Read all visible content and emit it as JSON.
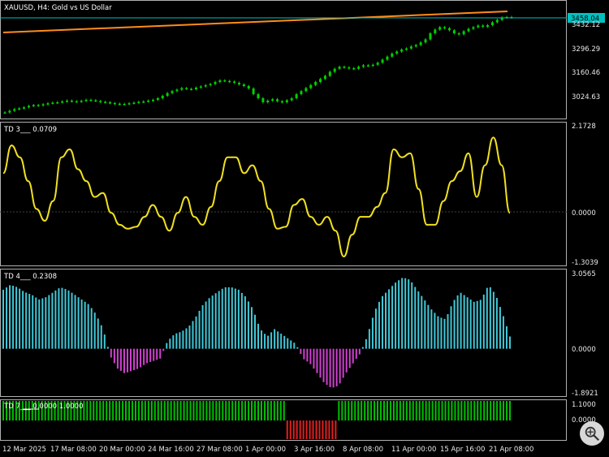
{
  "main": {
    "title": "XAUUSD, H4:  Gold vs US Dollar",
    "price_tag": "3458.04",
    "price_ticks": [
      "3432.12",
      "3296.29",
      "3160.46",
      "3024.63"
    ],
    "prices": [
      2990,
      2998,
      3006,
      3010,
      3015,
      3022,
      3026,
      3024,
      3030,
      3035,
      3038,
      3040,
      3044,
      3048,
      3045,
      3043,
      3047,
      3052,
      3050,
      3046,
      3042,
      3040,
      3036,
      3033,
      3030,
      3032,
      3035,
      3038,
      3042,
      3044,
      3048,
      3052,
      3060,
      3072,
      3085,
      3095,
      3102,
      3110,
      3106,
      3104,
      3112,
      3118,
      3124,
      3130,
      3140,
      3148,
      3145,
      3142,
      3136,
      3128,
      3120,
      3108,
      3080,
      3060,
      3040,
      3048,
      3055,
      3045,
      3040,
      3050,
      3060,
      3080,
      3095,
      3110,
      3125,
      3140,
      3155,
      3170,
      3190,
      3205,
      3215,
      3212,
      3208,
      3205,
      3215,
      3222,
      3220,
      3225,
      3235,
      3250,
      3265,
      3280,
      3290,
      3300,
      3305,
      3315,
      3322,
      3335,
      3350,
      3380,
      3398,
      3410,
      3405,
      3395,
      3380,
      3375,
      3390,
      3402,
      3410,
      3418,
      3412,
      3420,
      3434,
      3446,
      3458,
      3460,
      3458
    ],
    "colors": {
      "price_line": "#00c0c0",
      "candle": "#00d000",
      "trend_line": "#ff8c1a"
    }
  },
  "td3": {
    "label": "TD 3___  0.0709",
    "ticks": [
      "2.1728",
      "0.0000",
      "-1.3039"
    ],
    "max": 2.1728,
    "min": -1.3039,
    "values": [
      1.0,
      1.7,
      1.4,
      0.8,
      0.1,
      -0.2,
      0.3,
      1.4,
      1.6,
      1.1,
      0.8,
      0.4,
      0.5,
      0.0,
      -0.3,
      -0.4,
      -0.35,
      -0.1,
      0.2,
      -0.1,
      -0.45,
      0.0,
      0.4,
      -0.1,
      -0.3,
      0.15,
      0.8,
      1.4,
      1.4,
      1.0,
      1.2,
      0.8,
      0.1,
      -0.4,
      -0.35,
      0.2,
      0.35,
      -0.1,
      -0.3,
      -0.1,
      -0.45,
      -1.1,
      -0.55,
      -0.1,
      -0.1,
      0.15,
      0.5,
      1.6,
      1.4,
      1.5,
      0.6,
      -0.3,
      -0.3,
      0.3,
      0.8,
      1.05,
      1.5,
      0.4,
      1.2,
      1.9,
      1.2,
      0.0
    ],
    "color": "#f0e020"
  },
  "td4": {
    "label": "TD 4___  0.2308",
    "ticks": [
      "3.0565",
      "0.0000",
      "-1.8921"
    ],
    "max": 3.0565,
    "min": -1.8921,
    "values": [
      2.4,
      2.6,
      2.5,
      2.3,
      2.2,
      2.0,
      2.1,
      2.3,
      2.5,
      2.4,
      2.2,
      2.0,
      1.8,
      1.4,
      0.8,
      -0.3,
      -0.8,
      -1.0,
      -0.9,
      -0.8,
      -0.6,
      -0.5,
      -0.4,
      0.3,
      0.6,
      0.7,
      0.9,
      1.3,
      1.8,
      2.1,
      2.3,
      2.5,
      2.5,
      2.4,
      2.1,
      1.6,
      0.8,
      0.5,
      0.8,
      0.6,
      0.4,
      0.2,
      -0.4,
      -0.6,
      -1.0,
      -1.4,
      -1.6,
      -1.5,
      -1.0,
      -0.6,
      -0.2,
      0.5,
      1.5,
      2.1,
      2.4,
      2.7,
      2.9,
      2.8,
      2.4,
      2.0,
      1.6,
      1.3,
      1.2,
      1.9,
      2.3,
      2.1,
      1.9,
      2.0,
      2.6,
      2.2,
      1.4,
      0.5
    ],
    "pos_color": "#40c8d8",
    "neg_color": "#d040d0"
  },
  "td7": {
    "label": "TD 7___  0.0000  1.0000",
    "ticks": [
      "1.1000",
      "0.0000"
    ],
    "states": [
      1,
      1,
      1,
      1,
      1,
      1,
      1,
      1,
      1,
      1,
      1,
      1,
      1,
      1,
      1,
      1,
      1,
      1,
      1,
      1,
      1,
      1,
      1,
      1,
      1,
      1,
      1,
      1,
      1,
      1,
      1,
      1,
      1,
      1,
      1,
      1,
      1,
      1,
      1,
      1,
      1,
      1,
      1,
      1,
      1,
      1,
      1,
      1,
      1,
      1,
      1,
      1,
      1,
      1,
      1,
      1,
      1,
      1,
      1,
      1,
      1,
      1,
      1,
      1,
      1,
      1,
      1,
      1,
      1,
      1,
      1,
      1,
      1,
      1,
      1,
      1,
      1,
      1,
      1,
      1,
      1,
      1,
      1,
      1,
      1,
      1,
      1,
      1,
      0,
      0,
      0,
      0,
      0,
      0,
      0,
      0,
      0,
      0,
      0,
      0,
      0,
      0,
      0,
      0,
      1,
      1,
      1,
      1,
      1,
      1,
      1,
      1,
      1,
      1,
      1,
      1,
      1,
      1,
      1,
      1,
      1,
      1,
      1,
      1,
      1,
      1,
      1,
      1,
      1,
      1,
      1,
      1,
      1,
      1,
      1,
      1,
      1,
      1,
      1,
      1,
      1,
      1,
      1,
      1,
      1,
      1,
      1,
      1,
      1,
      1,
      1,
      1,
      1,
      1,
      1,
      1,
      1,
      1
    ],
    "green": "#00c000",
    "red": "#e02020"
  },
  "xaxis": {
    "labels": [
      "12 Mar 2025",
      "17 Mar 08:00",
      "20 Mar 00:00",
      "24 Mar 16:00",
      "27 Mar 08:00",
      "1 Apr 00:00",
      "3 Apr 16:00",
      "8 Apr 08:00",
      "11 Apr 00:00",
      "15 Apr 16:00",
      "21 Apr 08:00"
    ]
  }
}
